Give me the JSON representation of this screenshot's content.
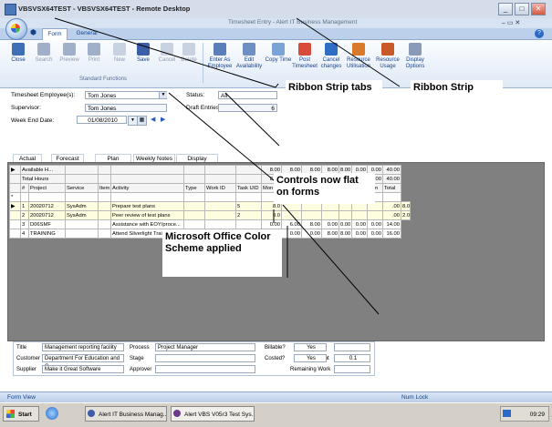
{
  "window": {
    "title": "VBSVSX64TEST - VBSVSX64TEST - Remote Desktop",
    "app_title": "Timesheet Entry - Alert IT Business Management"
  },
  "ribbon": {
    "tabs": [
      "Form",
      "General"
    ],
    "buttons": [
      {
        "label": "Close",
        "icon": "close-icon",
        "enabled": true
      },
      {
        "label": "Search",
        "icon": "binoculars-icon",
        "enabled": false
      },
      {
        "label": "Preview",
        "icon": "preview-icon",
        "enabled": false
      },
      {
        "label": "Print",
        "icon": "printer-icon",
        "enabled": false
      },
      {
        "label": "New",
        "icon": "new-document-icon",
        "enabled": false
      },
      {
        "label": "Save",
        "icon": "save-icon",
        "enabled": true
      },
      {
        "label": "Cancel",
        "icon": "cancel-icon",
        "enabled": false
      },
      {
        "label": "Delete",
        "icon": "delete-icon",
        "enabled": false
      }
    ],
    "group_label": "Standard Functions",
    "right_buttons": [
      {
        "label": "Enter As Employee",
        "icon": "employee-icon"
      },
      {
        "label": "Edit Availability",
        "icon": "calendar-icon"
      },
      {
        "label": "Copy Time",
        "icon": "copy-icon"
      },
      {
        "label": "Post Timesheet",
        "icon": "post-icon"
      },
      {
        "label": "Cancel changes",
        "icon": "undo-icon"
      },
      {
        "label": "Resource Utilisation",
        "icon": "people-icon"
      },
      {
        "label": "Resource Usage",
        "icon": "people-chart-icon"
      },
      {
        "label": "Display Options",
        "icon": "options-icon"
      }
    ]
  },
  "form": {
    "employee_label": "Timesheet Employee(s):",
    "employee_value": "Tom Jones",
    "supervisor_label": "Supervisor:",
    "supervisor_value": "Tom Jones",
    "week_end_label": "Week End Date:",
    "week_end_value": "01/08/2010",
    "status_label": "Status:",
    "status_value": "All",
    "draft_label": "Draft Entries:",
    "draft_value": "6",
    "subtabs": [
      "Actual",
      "Forecast",
      "Plan",
      "Weekly Notes",
      "Display Options"
    ]
  },
  "grid": {
    "summary_rows": [
      {
        "label": "Available H...",
        "values": [
          "8.00",
          "8.00",
          "8.00",
          "8.00",
          "8.00",
          "0.00",
          "0.00",
          "40.00"
        ]
      },
      {
        "label": "Total Hours",
        "values": [
          "8.00",
          "8.00",
          "8.00",
          "8.00",
          "8.00",
          "0.00",
          "0.00",
          "40.00"
        ]
      }
    ],
    "columns": [
      "#",
      "Project",
      "Service",
      "Item",
      "Activity",
      "Type",
      "Work ID",
      "Task UID",
      "Mon",
      "Tue",
      "Wed",
      "Thu",
      "Fri",
      "Sat",
      "Sun",
      "Total"
    ],
    "rows": [
      {
        "num": "1",
        "project": "20020712",
        "service": "SysAdm",
        "item": "",
        "activity": "Prepare test plans",
        "type": "",
        "work_id": "",
        "task_uid": "5",
        "days": [
          "8.0",
          "",
          "",
          "",
          "",
          "",
          "",
          ".00",
          "8.00"
        ]
      },
      {
        "num": "2",
        "project": "20020712",
        "service": "SysAdm",
        "item": "",
        "activity": "Peer review of test plans",
        "type": "",
        "work_id": "",
        "task_uid": "2",
        "days": [
          "0.0",
          "",
          "",
          "",
          "",
          "",
          "",
          ".00",
          "2.00"
        ]
      },
      {
        "num": "3",
        "project": "D06SMF",
        "service": "",
        "item": "",
        "activity": "Assistance with EOY/proce...",
        "type": "",
        "work_id": "",
        "task_uid": "",
        "days": [
          "0.00",
          "6.00",
          "8.00",
          "0.00",
          "0.00",
          "0.00",
          "0.00",
          "14.00"
        ]
      },
      {
        "num": "4",
        "project": "TRAINING",
        "service": "",
        "item": "",
        "activity": "Attend Silverlight Training",
        "type": "",
        "work_id": "",
        "task_uid": "",
        "days": [
          "0.00",
          "0.00",
          "0.00",
          "8.00",
          "8.00",
          "0.00",
          "0.00",
          "16.00"
        ]
      }
    ]
  },
  "details": {
    "title_label": "Title",
    "title_value": "Management reporting facility",
    "customer_label": "Customer",
    "customer_value": "Department For Education and C",
    "supplier_label": "Supplier",
    "supplier_value": "Make it Great Software",
    "process_label": "Process",
    "process_value": "Project Manager",
    "stage_label": "Stage",
    "stage_value": "",
    "approver_label": "Approver",
    "approver_value": "",
    "billable_label": "Billable?",
    "billable_value": "Yes",
    "costed_label": "Costed?",
    "costed_value": "Yes",
    "entity_label": "Entity",
    "entity_value": "",
    "increment_label": "Increment",
    "increment_value": "0.1",
    "remaining_label": "Remaining Work",
    "remaining_value": ""
  },
  "status_bar": {
    "left": "Form View",
    "right": "Num Lock"
  },
  "taskbar": {
    "start": "Start",
    "items": [
      "Alert IT Business Manag...",
      "Alert VBS V05r3 Test Sys..."
    ],
    "time": "09:29"
  },
  "callouts": {
    "ribbon_tabs": "Ribbon Strip tabs",
    "ribbon_strip": "Ribbon Strip",
    "controls_flat": "Controls now flat on forms",
    "office_scheme": "Microsoft Office Color Scheme applied"
  }
}
